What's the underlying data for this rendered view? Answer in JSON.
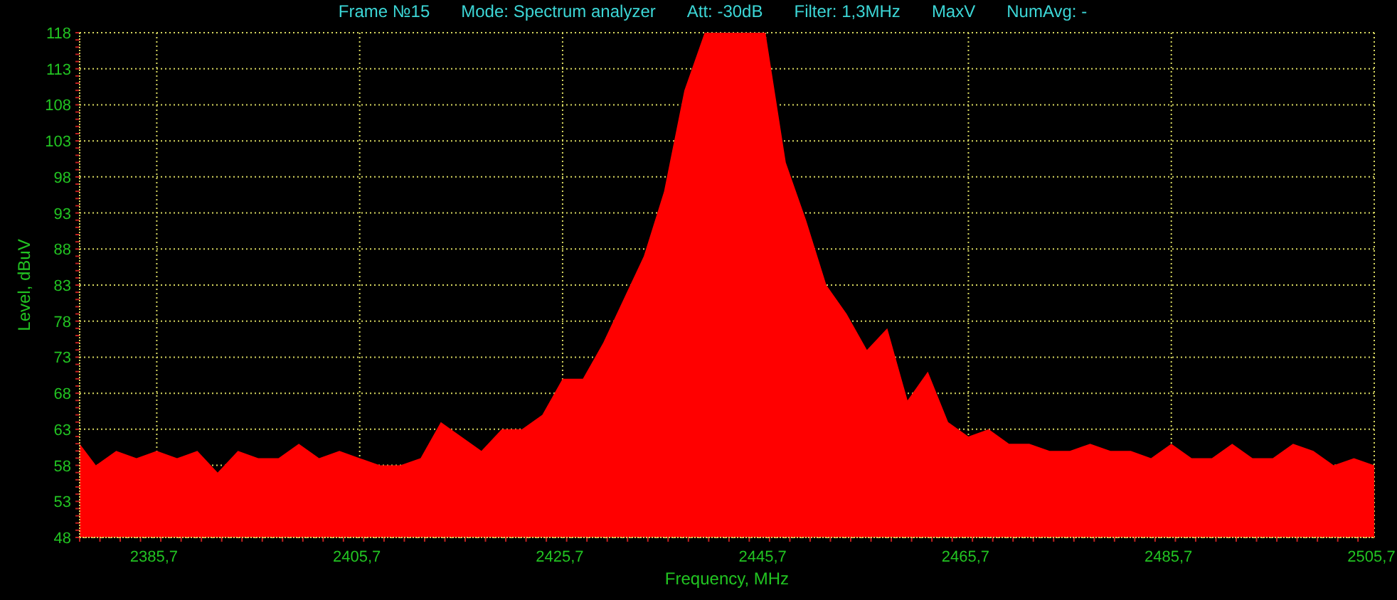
{
  "header": {
    "items": [
      "Frame №15",
      "Mode: Spectrum analyzer",
      "Att: -30dB",
      "Filter: 1,3MHz",
      "MaxV",
      "NumAvg: -"
    ]
  },
  "chart": {
    "chart_data": {
      "type": "area",
      "xlabel": "Frequency, MHz",
      "ylabel": "Level, dBuV",
      "x": [
        2378.1,
        2379.7,
        2381.7,
        2383.7,
        2385.7,
        2387.7,
        2389.7,
        2391.7,
        2393.7,
        2395.7,
        2397.7,
        2399.7,
        2401.7,
        2403.7,
        2405.7,
        2407.7,
        2409.7,
        2411.7,
        2413.7,
        2415.7,
        2417.7,
        2419.7,
        2421.7,
        2423.7,
        2425.7,
        2427.7,
        2429.7,
        2431.7,
        2433.7,
        2435.7,
        2437.7,
        2439.7,
        2441.7,
        2443.7,
        2445.7,
        2447.7,
        2449.7,
        2451.7,
        2453.7,
        2455.7,
        2457.7,
        2459.7,
        2461.7,
        2463.7,
        2465.7,
        2467.7,
        2469.7,
        2471.7,
        2473.7,
        2475.7,
        2477.7,
        2479.7,
        2481.7,
        2483.7,
        2485.7,
        2487.7,
        2489.7,
        2491.7,
        2493.7,
        2495.7,
        2497.7,
        2499.7,
        2501.7,
        2503.7,
        2505.7
      ],
      "series": [
        {
          "color": "#ff0000",
          "values": [
            61,
            58,
            60,
            59,
            60,
            59,
            60,
            57,
            60,
            59,
            59,
            61,
            59,
            60,
            59,
            58,
            58,
            59,
            64,
            62,
            60,
            63,
            63,
            65,
            70,
            70,
            75,
            81,
            87,
            96,
            110,
            118,
            118,
            118,
            118,
            100,
            92,
            83,
            79,
            74,
            77,
            67,
            71,
            64,
            62,
            63,
            61,
            61,
            60,
            60,
            61,
            60,
            60,
            59,
            61,
            59,
            59,
            61,
            59,
            59,
            61,
            60,
            58,
            59,
            58
          ]
        }
      ],
      "grid": true,
      "xlim": [
        2378.1,
        2505.7
      ],
      "ylim": [
        48,
        118
      ],
      "xticks": [
        {
          "value": 2385.7,
          "label": "2385,7"
        },
        {
          "value": 2405.7,
          "label": "2405,7"
        },
        {
          "value": 2425.7,
          "label": "2425,7"
        },
        {
          "value": 2445.7,
          "label": "2445,7"
        },
        {
          "value": 2465.7,
          "label": "2465,7"
        },
        {
          "value": 2485.7,
          "label": "2485,7"
        },
        {
          "value": 2505.7,
          "label": "2505,7"
        }
      ],
      "yticks": [
        48,
        53,
        58,
        63,
        68,
        73,
        78,
        83,
        88,
        93,
        98,
        103,
        108,
        113,
        118
      ]
    }
  }
}
